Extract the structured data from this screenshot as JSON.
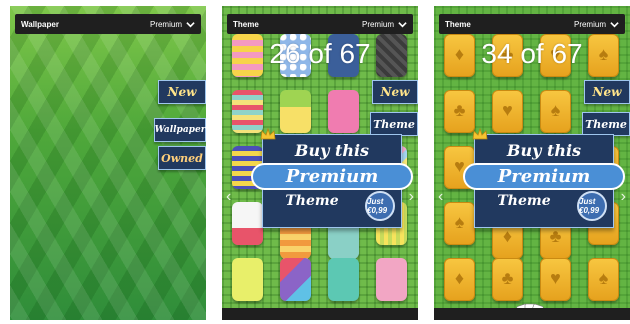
{
  "panels": [
    {
      "title": "Wallpaper",
      "menu_label": "Premium",
      "ribbons": [
        {
          "label": "New"
        },
        {
          "label": "Wallpaper"
        },
        {
          "label": "Owned"
        }
      ]
    },
    {
      "title": "Theme",
      "menu_label": "Premium",
      "counter": "26 of 67",
      "ribbons": [
        {
          "label": "New"
        },
        {
          "label": "Theme"
        }
      ],
      "banner": {
        "line1": "Buy this",
        "line2": "Premium",
        "line3": "Theme",
        "price": "Just €0,99"
      }
    },
    {
      "title": "Theme",
      "menu_label": "Premium",
      "counter": "34 of 67",
      "ribbons": [
        {
          "label": "New"
        },
        {
          "label": "Theme"
        }
      ],
      "banner": {
        "line1": "Buy this",
        "line2": "Premium",
        "line3": "Theme",
        "price": "Just €0,99"
      }
    }
  ],
  "icons": {
    "dropdown": "chevron-down-icon",
    "prev": "chevron-left-icon",
    "next": "chevron-right-icon",
    "crown": "crown-icon",
    "cards": "playing-cards-icon"
  },
  "colors": {
    "bar": "#1f1f1f",
    "ribbon": "#21395f",
    "premium_pill": "#4a8fd6",
    "gold_tile": "#f2b52e",
    "green": "#5fb140"
  }
}
